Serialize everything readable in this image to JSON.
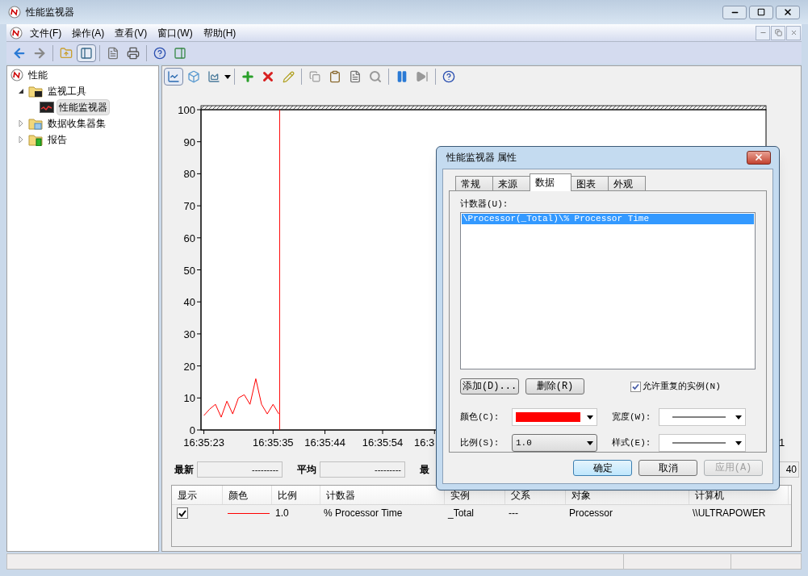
{
  "window": {
    "title": "性能监视器"
  },
  "menu": [
    "文件(F)",
    "操作(A)",
    "查看(V)",
    "窗口(W)",
    "帮助(H)"
  ],
  "tree": [
    {
      "label": "性能",
      "selected": false,
      "children": [
        {
          "label": "监视工具",
          "selected": false,
          "expanded": true,
          "children": [
            {
              "label": "性能监视器",
              "selected": true
            }
          ]
        },
        {
          "label": "数据收集器集",
          "selected": false,
          "expanded": false
        },
        {
          "label": "报告",
          "selected": false,
          "expanded": false
        }
      ]
    }
  ],
  "chart": {
    "chart_data": {
      "type": "line",
      "categories": [
        "16:35:23",
        null,
        null,
        null,
        null,
        null,
        null,
        null,
        null,
        null,
        null,
        null,
        "16:35:35",
        null,
        null,
        null,
        null,
        null,
        null,
        null,
        null,
        "16:35:44",
        null,
        null,
        null,
        null,
        null,
        null,
        null,
        null,
        null,
        "16:35:54",
        null,
        null,
        null,
        null,
        null,
        null,
        null,
        null,
        "16:3",
        null,
        null,
        null,
        null,
        null,
        null,
        null,
        null,
        null,
        null,
        null,
        null,
        null,
        null,
        null,
        null,
        null,
        null,
        null,
        null,
        null,
        null,
        null,
        null,
        null,
        null,
        null,
        null,
        null,
        null,
        null,
        null,
        null,
        null,
        null,
        null,
        null,
        null,
        null,
        null,
        null,
        null,
        null,
        null,
        null,
        null,
        null,
        null,
        null,
        null,
        null,
        null,
        null,
        null,
        null,
        null,
        null
      ],
      "series": [
        {
          "color": "#ff0000",
          "values": [
            4.5,
            6.5,
            8,
            4,
            9,
            5,
            10,
            11,
            8,
            16,
            8,
            5,
            8,
            5,
            null,
            null,
            null,
            null,
            null,
            null,
            null,
            null,
            null,
            null,
            null,
            null,
            null,
            null,
            null,
            null,
            null,
            null,
            null,
            null,
            null,
            null,
            null,
            null,
            null,
            null,
            null,
            null,
            null,
            null,
            null,
            null,
            null,
            null,
            null,
            null,
            null,
            null,
            null,
            null,
            null,
            null,
            null,
            null,
            null,
            null,
            null,
            null,
            null,
            null,
            null,
            null,
            null,
            null,
            null,
            null,
            null,
            null,
            null,
            null,
            null,
            null,
            null,
            null,
            null,
            null,
            null,
            null,
            null,
            null,
            null,
            null,
            null,
            null,
            null,
            null,
            null,
            null,
            null,
            null,
            null,
            null,
            null,
            null
          ]
        }
      ],
      "ylim": [
        0,
        100
      ],
      "yticks": [
        0,
        10,
        20,
        30,
        40,
        50,
        60,
        70,
        80,
        90,
        100
      ]
    },
    "edge_label": "1"
  },
  "stats": [
    {
      "label": "最新",
      "value": "---------"
    },
    {
      "label": "平均",
      "value": "---------"
    },
    {
      "label": "最"
    }
  ],
  "stats_edge_value": "40",
  "table": {
    "columns": [
      "显示",
      "颜色",
      "比例",
      "计数器",
      "实例",
      "父系",
      "对象",
      "计算机"
    ],
    "rows": [
      {
        "shown": true,
        "color": "#ff0000",
        "scale": "1.0",
        "counter": "% Processor Time",
        "instance": "_Total",
        "parent": "---",
        "object": "Processor",
        "computer": "\\\\ULTRAPOWER"
      }
    ]
  },
  "dialog": {
    "title": "性能监视器 属性",
    "tabs": [
      {
        "label": "常规",
        "selected": false
      },
      {
        "label": "来源",
        "selected": false
      },
      {
        "label": "数据",
        "selected": true
      },
      {
        "label": "图表",
        "selected": false
      },
      {
        "label": "外观",
        "selected": false
      }
    ],
    "counters_label": "计数器(U):",
    "counters": [
      {
        "text": "\\Processor(_Total)\\% Processor Time",
        "selected": true
      }
    ],
    "add_button": "添加(D)...",
    "remove_button": "删除(R)",
    "allow_duplicates": {
      "label": "允许重复的实例(N)",
      "checked": true
    },
    "fields": [
      {
        "kind": "color",
        "label": "颜色(C):",
        "color": "#ff0000"
      },
      {
        "kind": "line",
        "label": "宽度(W):"
      },
      {
        "kind": "select",
        "label": "比例(S):",
        "value": "1.0"
      },
      {
        "kind": "line",
        "label": "样式(E):"
      }
    ],
    "buttons": [
      {
        "label": "确定",
        "kind": "default",
        "disabled": false
      },
      {
        "label": "取消",
        "kind": "normal",
        "disabled": false
      },
      {
        "label": "应用(A)",
        "kind": "normal",
        "disabled": true
      }
    ]
  }
}
